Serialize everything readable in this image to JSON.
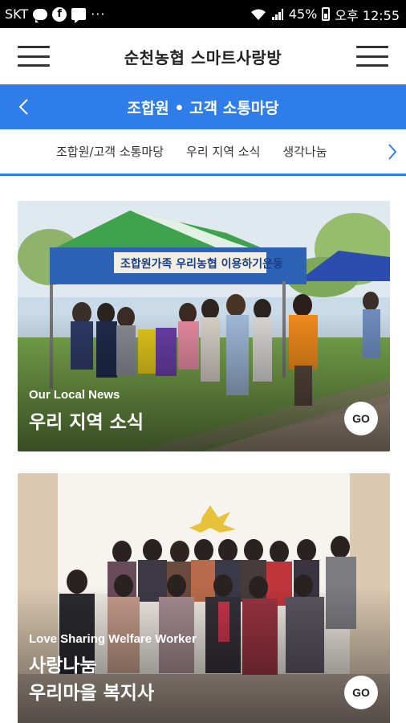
{
  "status_bar": {
    "carrier": "SKT",
    "more": "···",
    "battery": "45%",
    "time": "오후 12:55"
  },
  "header": {
    "title": "순천농협 스마트사랑방"
  },
  "section_bar": {
    "title": "조합원 • 고객 소통마당"
  },
  "tabs": {
    "items": [
      "조합원/고객 소통마당",
      "우리 지역 소식",
      "생각나눔"
    ]
  },
  "cards": [
    {
      "subtitle": "Our Local News",
      "title_lines": [
        "우리 지역 소식"
      ],
      "go_label": "GO",
      "banner_text": "조합원가족 우리농협 이용하기운동"
    },
    {
      "subtitle": "Love Sharing Welfare Worker",
      "title_lines": [
        "사랑나눔",
        "우리마을 복지사"
      ],
      "go_label": "GO"
    }
  ],
  "colors": {
    "accent": "#2f7de8",
    "status_bar_bg": "#000000"
  }
}
